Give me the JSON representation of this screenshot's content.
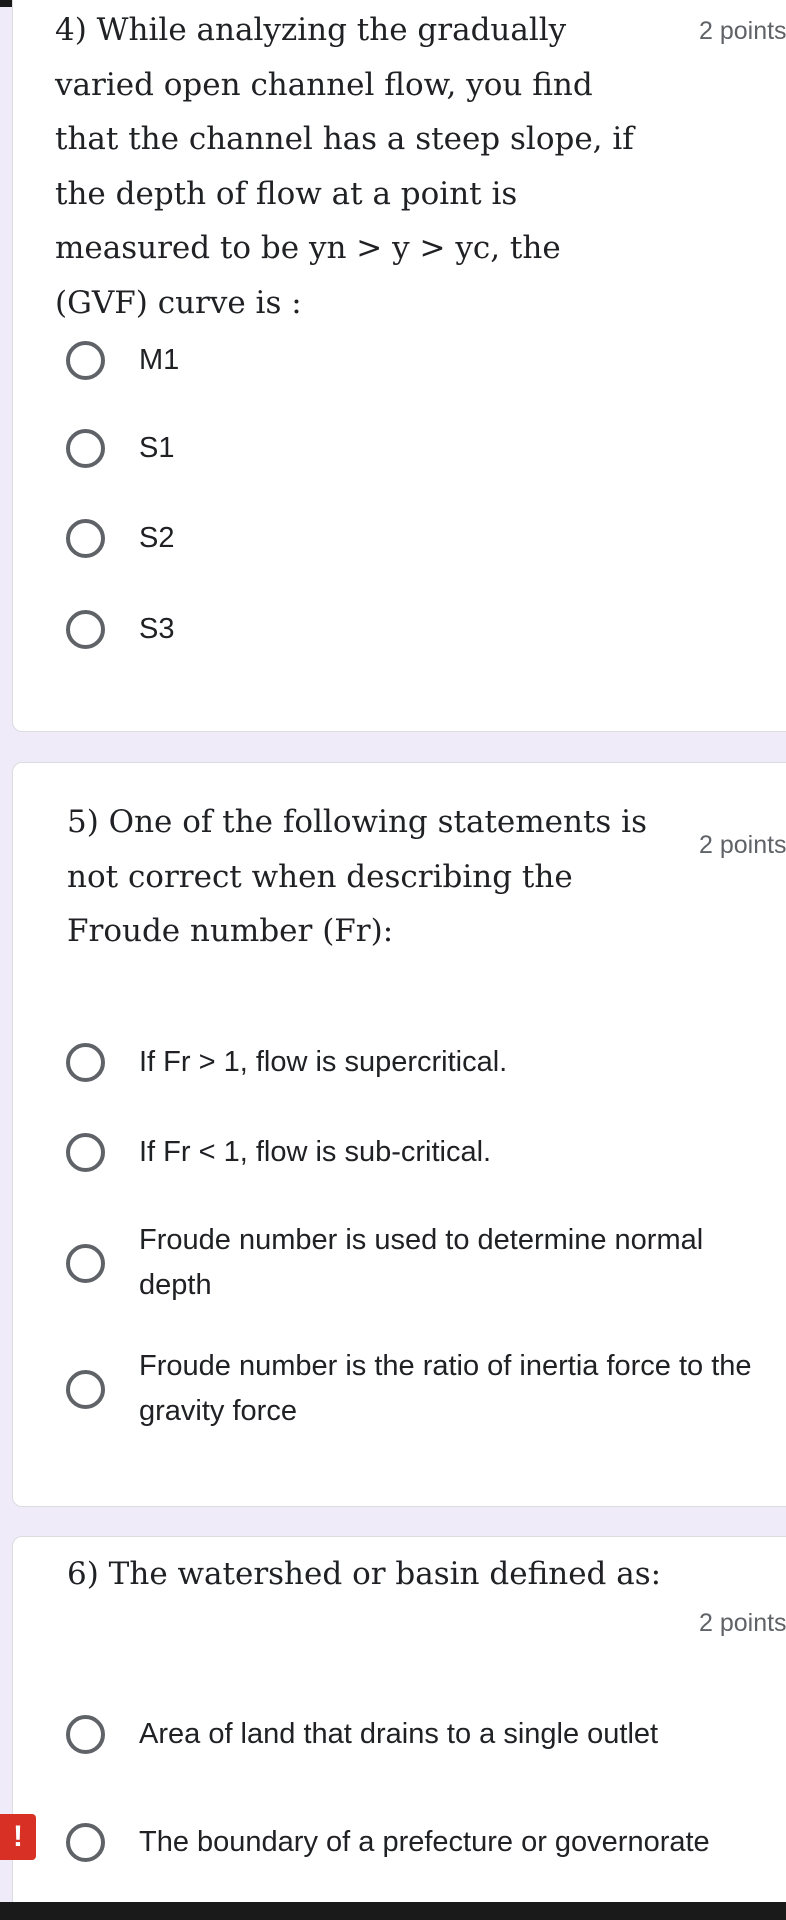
{
  "questions": [
    {
      "title": "4) While analyzing the gradually varied open channel flow, you find that the channel has a steep slope, if the depth of flow at a point is measured to be yn > y > yc, the (GVF) curve is :",
      "points": "2 points",
      "options": [
        "M1",
        "S1",
        "S2",
        "S3"
      ]
    },
    {
      "title": "5) One of the following statements is not correct when describing the Froude number (Fr):",
      "points": "2 points",
      "options": [
        "If Fr > 1, flow is supercritical.",
        "If Fr < 1, flow is sub-critical.",
        "Froude number is used to determine normal depth",
        "Froude number is the ratio of inertia force to the gravity force"
      ]
    },
    {
      "title": "6) The watershed or basin defined as:",
      "points": "2 points",
      "options": [
        "Area of land that drains to a single outlet",
        "The boundary of a prefecture or governorate"
      ]
    }
  ],
  "alert_icon": "!",
  "icon_names": {
    "radio": "radio-unchecked-icon",
    "alert": "exclamation-icon"
  },
  "colors": {
    "page_background": "#f0ebf8",
    "card_background": "#ffffff",
    "text": "#202124",
    "secondary_text": "#5f6368",
    "alert": "#d93025"
  }
}
